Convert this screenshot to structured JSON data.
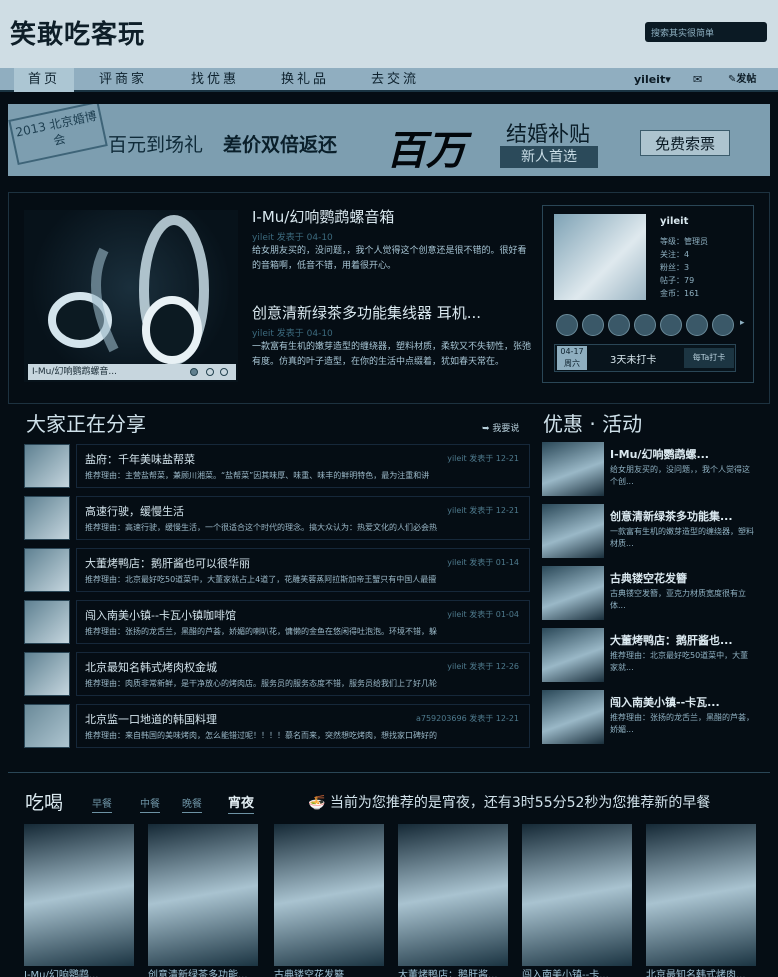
{
  "site": {
    "logo": "笑敢吃客玩"
  },
  "search": {
    "placeholder": "搜索其实很简单"
  },
  "nav": {
    "items": [
      "首页",
      "评商家",
      "找优惠",
      "换礼品",
      "去交流"
    ],
    "user": "yileit▾",
    "mail_icon": "mail-icon",
    "post": "✎发帖"
  },
  "banner": {
    "expo": "2013 北京婚博会",
    "text1": "百元到场礼",
    "text2": "差价双倍返还",
    "big": "百万",
    "text3": "结婚补贴",
    "tag": "新人首选",
    "button": "免费索票"
  },
  "feature": {
    "caption": "I-Mu/幻响鹦鹉螺音...",
    "items": [
      {
        "title": "I-Mu/幻响鹦鹉螺音箱",
        "meta": "yileit 发表于 04-10",
        "body": [
          "给女朋友买的，没问题，，我个人觉得这个创意还是很不错的。很好看的音箱啊，低音不错，用着很开心。"
        ]
      },
      {
        "title": "创意清新绿茶多功能集线器 耳机...",
        "meta": "yileit 发表于 04-10",
        "body": [
          "一款富有生机的嫩芽造型的缠绕器，塑料材质，柔软又不失韧性，张弛有度。仿真的叶子造型，在你的生活中点缀着，犹如春天常在。"
        ]
      }
    ]
  },
  "profile": {
    "name": "yileit",
    "stats": [
      "等级：管理员",
      "关注：4",
      "粉丝：3",
      "帖子：79",
      "金币：161"
    ],
    "checkin_date": "04-17 周六",
    "checkin_status": "3天未打卡",
    "checkin_btn": "每Ta打卡"
  },
  "share": {
    "heading": "大家正在分享",
    "recommend": "➥ 我要说",
    "rows": [
      {
        "title": "盐府：千年美味盐帮菜",
        "meta": "yileit 发表于 12-21",
        "desc": "推荐理由：主营盐帮菜，兼顾川湘菜。“盐帮菜”因其味厚、味重、味丰的鲜明特色，最为注重和讲"
      },
      {
        "title": "高速行驶，缓慢生活",
        "meta": "yileit 发表于 12-21",
        "desc": "推荐理由：高速行驶，缓慢生活，一个很适合这个时代的理念。搞大众认为：热爱文化的人们必会热"
      },
      {
        "title": "大董烤鸭店：鹅肝酱也可以很华丽",
        "meta": "yileit 发表于 01-14",
        "desc": "推荐理由：北京最好吃50道菜中，大董家就占上4道了，花雕芙蓉蒸阿拉斯加帝王蟹只有中国人最擅"
      },
      {
        "title": "闯入南美小镇--卡瓦小镇咖啡馆",
        "meta": "yileit 发表于 01-04",
        "desc": "推荐理由：张扬的龙舌兰，黑醋的芦荟，娇媚的喇叭花，慵懒的金鱼在悠闲得吐泡泡。环境不错，躲"
      },
      {
        "title": "北京最知名韩式烤肉权金城",
        "meta": "yileit 发表于 12-26",
        "desc": "推荐理由：肉质非常新鲜，是干净放心的烤肉店。服务员的服务态度不错，服务员给我们上了好几轮"
      },
      {
        "title": "北京监一口地道的韩国料理",
        "meta": "a759203696 发表于 12-21",
        "desc": "推荐理由：来自韩国的美味烤肉，怎么能错过呢！！！！慕名而来，突然想吃烤肉，想找家口碑好的"
      }
    ]
  },
  "promo": {
    "heading": "优惠 · 活动",
    "items": [
      {
        "title": "I-Mu/幻响鹦鹉螺...",
        "desc": "给女朋友买的，没问题，，我个人觉得这个创..."
      },
      {
        "title": "创意清新绿茶多功能集...",
        "desc": "一款富有生机的嫩芽造型的缠绕器，塑料材质..."
      },
      {
        "title": "古典镂空花发簪",
        "desc": "古典镂空发簪，亚克力材质宽度很有立体..."
      },
      {
        "title": "大董烤鸭店：鹅肝酱也...",
        "desc": "推荐理由：北京最好吃50道菜中，大董家就..."
      },
      {
        "title": "闯入南美小镇--卡瓦...",
        "desc": "推荐理由：张扬的龙舌兰，黑醋的芦荟，娇媚..."
      }
    ]
  },
  "food": {
    "title": "吃喝",
    "tabs": [
      "早餐",
      "中餐",
      "晚餐",
      "宵夜"
    ],
    "active_tab": 3,
    "notice": "当前为您推荐的是宵夜，还有3时55分52秒为您推荐新的早餐",
    "captions": [
      "I-Mu/幻响鹦鹉...",
      "创意清新绿茶多功能...",
      "古典镂空花发簪",
      "大董烤鸭店：鹅肝酱...",
      "闯入南美小镇--卡...",
      "北京最知名韩式烤肉..."
    ]
  }
}
